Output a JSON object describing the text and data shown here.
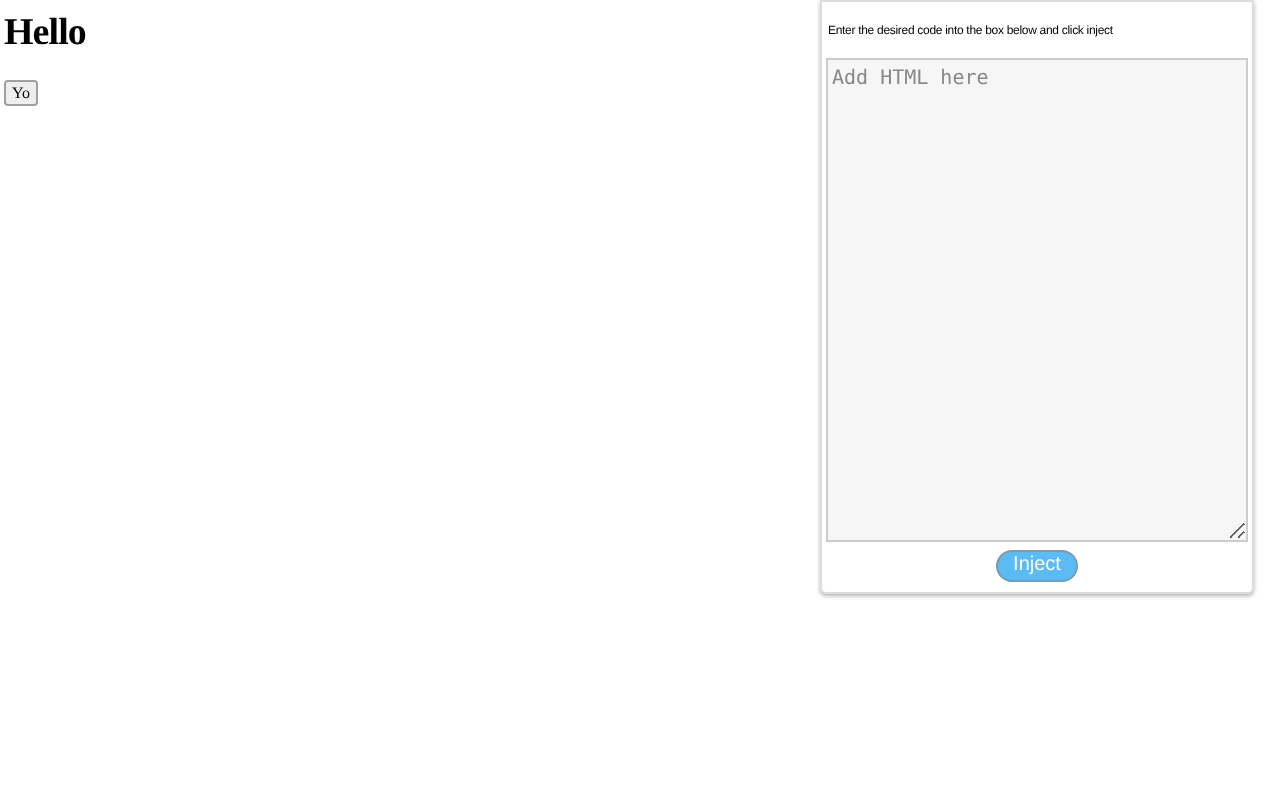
{
  "page": {
    "heading": "Hello",
    "button": "Yo"
  },
  "panel": {
    "instructions": "Enter the desired code into the box below and click inject",
    "editor": {
      "placeholder": "Add HTML here"
    },
    "button": "Inject"
  }
}
